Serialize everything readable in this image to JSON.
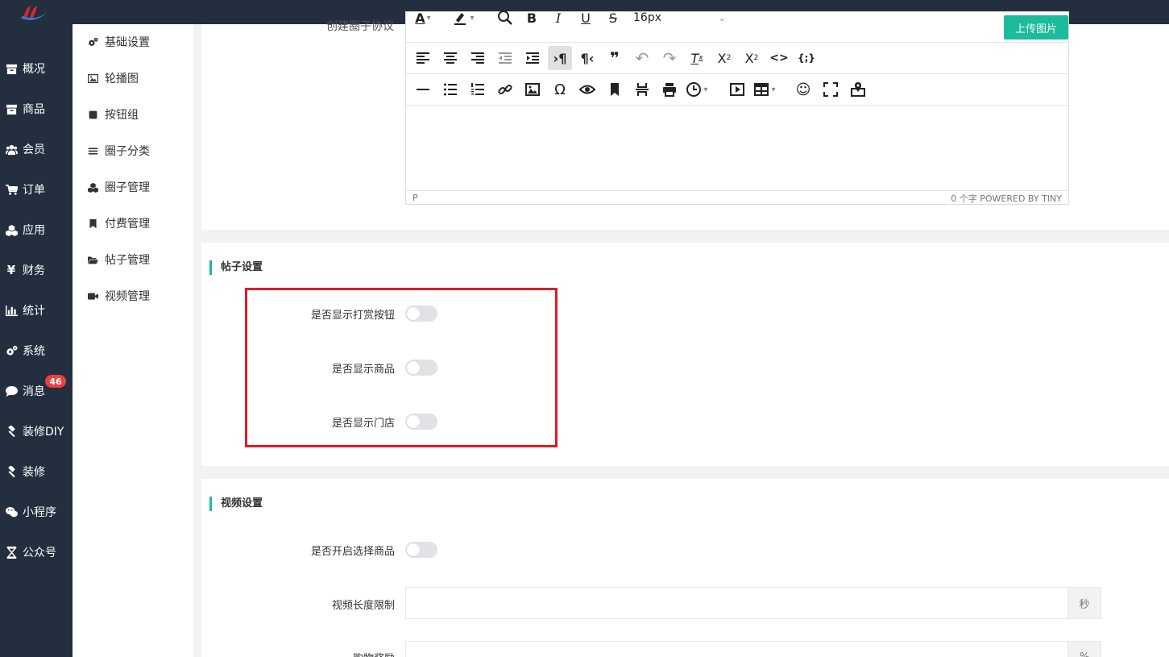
{
  "sidebar": {
    "items": [
      {
        "label": "概况",
        "icon": "archive-icon"
      },
      {
        "label": "商品",
        "icon": "archive-icon"
      },
      {
        "label": "会员",
        "icon": "users-icon"
      },
      {
        "label": "订单",
        "icon": "cart-icon"
      },
      {
        "label": "应用",
        "icon": "cubes-icon"
      },
      {
        "label": "财务",
        "icon": "yen-icon"
      },
      {
        "label": "统计",
        "icon": "bar-chart-icon"
      },
      {
        "label": "系统",
        "icon": "gears-icon"
      },
      {
        "label": "消息",
        "icon": "comment-icon",
        "badge": "46"
      },
      {
        "label": "装修DIY",
        "icon": "gavel-icon"
      },
      {
        "label": "装修",
        "icon": "gavel-icon"
      },
      {
        "label": "小程序",
        "icon": "wechat-icon"
      },
      {
        "label": "公众号",
        "icon": "hourglass-icon"
      }
    ]
  },
  "submenu": {
    "items": [
      {
        "label": "基础设置",
        "icon": "gears-icon"
      },
      {
        "label": "轮播图",
        "icon": "image-icon"
      },
      {
        "label": "按钮组",
        "icon": "square-icon"
      },
      {
        "label": "圈子分类",
        "icon": "list-icon"
      },
      {
        "label": "圈子管理",
        "icon": "cubes-icon"
      },
      {
        "label": "付费管理",
        "icon": "bookmark-icon"
      },
      {
        "label": "帖子管理",
        "icon": "folder-open-icon"
      },
      {
        "label": "视频管理",
        "icon": "video-camera-icon"
      }
    ]
  },
  "editor": {
    "label": "创建圈子协议",
    "font_size": "16px",
    "upload_label": "上传图片",
    "status_path": "P",
    "status_right": "0 个字  POWERED BY TINY"
  },
  "post_settings": {
    "title": "帖子设置",
    "fields": [
      {
        "label": "是否显示打赏按钮",
        "value": false
      },
      {
        "label": "是否显示商品",
        "value": false
      },
      {
        "label": "是否显示门店",
        "value": false
      }
    ]
  },
  "video_settings": {
    "title": "视频设置",
    "select_goods_label": "是否开启选择商品",
    "select_goods_value": false,
    "length_label": "视频长度限制",
    "length_value": "",
    "length_suffix": "秒",
    "reward_label": "购物奖励",
    "reward_value": "",
    "reward_suffix": "%"
  },
  "colors": {
    "sidebar_bg": "#232f3e",
    "accent": "#1bbc9b",
    "badge": "#ed4040",
    "highlight": "#e01b24"
  }
}
